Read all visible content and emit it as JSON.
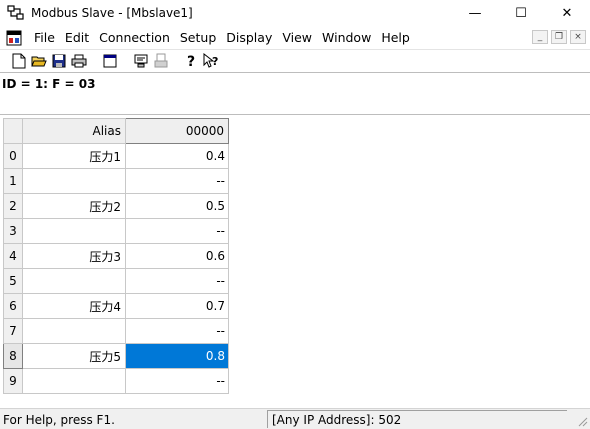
{
  "window": {
    "title": "Modbus Slave - [Mbslave1]",
    "minimize_glyph": "—",
    "maximize_glyph": "☐",
    "close_glyph": "✕"
  },
  "menu": {
    "items": [
      "File",
      "Edit",
      "Connection",
      "Setup",
      "Display",
      "View",
      "Window",
      "Help"
    ]
  },
  "mdi": {
    "minimize_glyph": "_",
    "restore_glyph": "❐",
    "close_glyph": "×"
  },
  "toolbar": {
    "icons": [
      "new-icon",
      "open-icon",
      "save-icon",
      "print-icon",
      "window-icon",
      "monitor-icon",
      "printer-setup-icon",
      "help-icon",
      "context-help-icon"
    ]
  },
  "header": {
    "id_text": "ID = 1: F = 03"
  },
  "grid": {
    "col_alias": "Alias",
    "col_value": "00000",
    "rows": [
      {
        "index": "0",
        "alias": "压力1",
        "value": "0.4"
      },
      {
        "index": "1",
        "alias": "",
        "value": "--"
      },
      {
        "index": "2",
        "alias": "压力2",
        "value": "0.5"
      },
      {
        "index": "3",
        "alias": "",
        "value": "--"
      },
      {
        "index": "4",
        "alias": "压力3",
        "value": "0.6"
      },
      {
        "index": "5",
        "alias": "",
        "value": "--"
      },
      {
        "index": "6",
        "alias": "压力4",
        "value": "0.7"
      },
      {
        "index": "7",
        "alias": "",
        "value": "--"
      },
      {
        "index": "8",
        "alias": "压力5",
        "value": "0.8"
      },
      {
        "index": "9",
        "alias": "",
        "value": "--"
      }
    ],
    "selected_row": 8,
    "selection_color": "#0078d7"
  },
  "status": {
    "help_text": "For Help, press F1.",
    "connection_text": "[Any IP Address]: 502"
  }
}
